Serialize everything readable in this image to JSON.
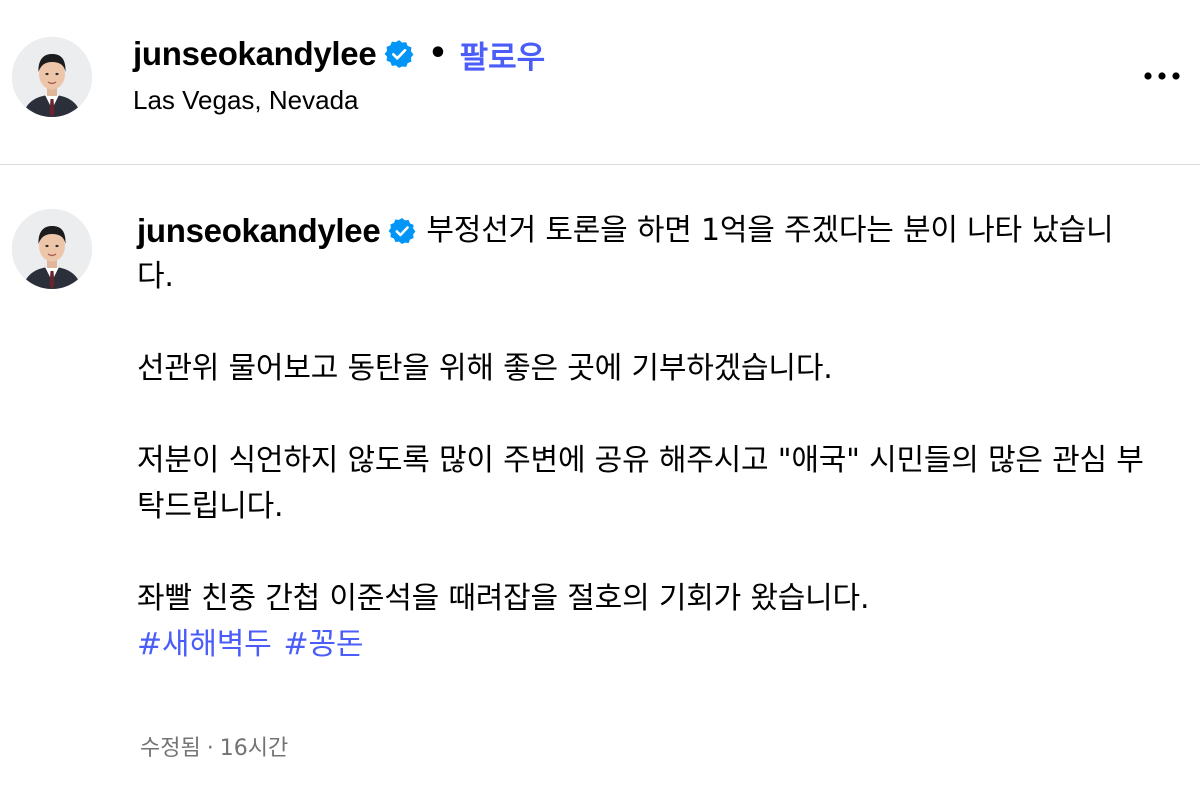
{
  "header": {
    "username": "junseokandylee",
    "verified_icon": "verified-badge-icon",
    "separator": "•",
    "follow_label": "팔로우",
    "location": "Las Vegas, Nevada",
    "more_icon": "more-options-icon"
  },
  "caption": {
    "username": "junseokandylee",
    "first_line_text": "부정선거 토론을 하면 1억을 주겠다는 분이 나타 났습니다.",
    "paragraphs": [
      "선관위 물어보고 동탄을 위해 좋은 곳에 기부하겠습니다.",
      "저분이 식언하지 않도록 많이 주변에 공유 해주시고 \"애국\" 시민들의 많은 관심 부탁드립니다.",
      "좌빨 친중 간첩 이준석을 때려잡을 절호의 기회가 왔습니다."
    ],
    "hashtags": [
      "#새해벽두",
      "#꽁돈"
    ],
    "edited_label": "수정됨",
    "meta_separator": "·",
    "time_ago": "16시간"
  },
  "colors": {
    "link_blue": "#4a5df9",
    "verified_blue": "#0095f6",
    "meta_gray": "#737373",
    "divider": "#dbdbdb"
  }
}
